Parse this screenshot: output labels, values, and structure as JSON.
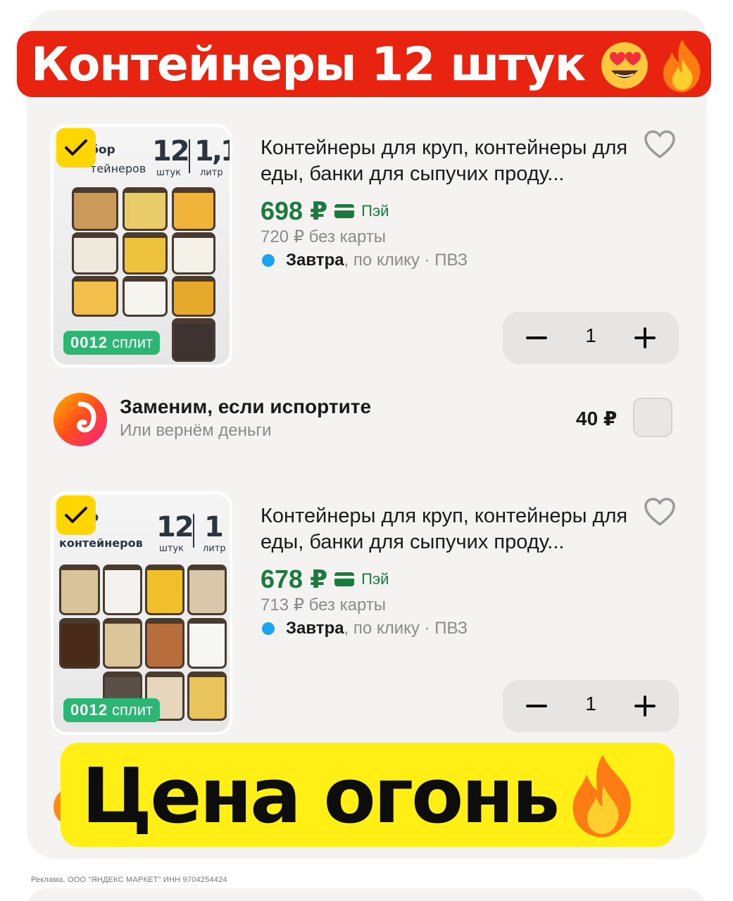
{
  "banner": {
    "title": "Контейнеры 12 штук"
  },
  "products": [
    {
      "image": {
        "header_title": "бор",
        "header_sub": "тейнеров",
        "count": "12",
        "count_label": "штук",
        "volume": "1,1",
        "volume_label": "литр",
        "split_digits": "0012",
        "split_label": "сплит"
      },
      "title": "Контейнеры для круп, контейнеры для еды, банки для сыпучих проду...",
      "price": "698 ₽",
      "pay_label": "Пэй",
      "old_price": "720 ₽ без карты",
      "delivery_day": "Завтра",
      "delivery_rest": ", по клику · ПВЗ",
      "quantity": "1"
    },
    {
      "image": {
        "header_title": "р",
        "header_sub": "контейнеров",
        "count": "12",
        "count_label": "штук",
        "volume": "1",
        "volume_label": "литр",
        "split_digits": "0012",
        "split_label": "сплит"
      },
      "title": "Контейнеры для круп, контейнеры для еды, банки для сыпучих проду...",
      "price": "678 ₽",
      "pay_label": "Пэй",
      "old_price": "713 ₽ без карты",
      "delivery_day": "Завтра",
      "delivery_rest": ", по клику · ПВЗ",
      "quantity": "1"
    }
  ],
  "replacement": {
    "title": "Заменим, если испортите",
    "subtitle": "Или вернём деньги",
    "price": "40 ₽"
  },
  "promo": {
    "text": "Цена огонь"
  },
  "ad_note": "Реклама. ООО \"ЯНДЕКС МАРКЕТ\" ИНН 9704254424",
  "colors": {
    "banner_red": "#e8230f",
    "promo_yellow": "#ffef14",
    "price_green": "#1b7a3e",
    "split_green": "#2bb673",
    "delivery_dot": "#1aa5f0",
    "check_yellow": "#ffd600"
  },
  "icons": [
    "heart-outline-icon",
    "checkmark-icon",
    "smiling-face-heart-eyes-emoji",
    "fire-emoji",
    "minus-icon",
    "plus-icon",
    "card-icon"
  ]
}
